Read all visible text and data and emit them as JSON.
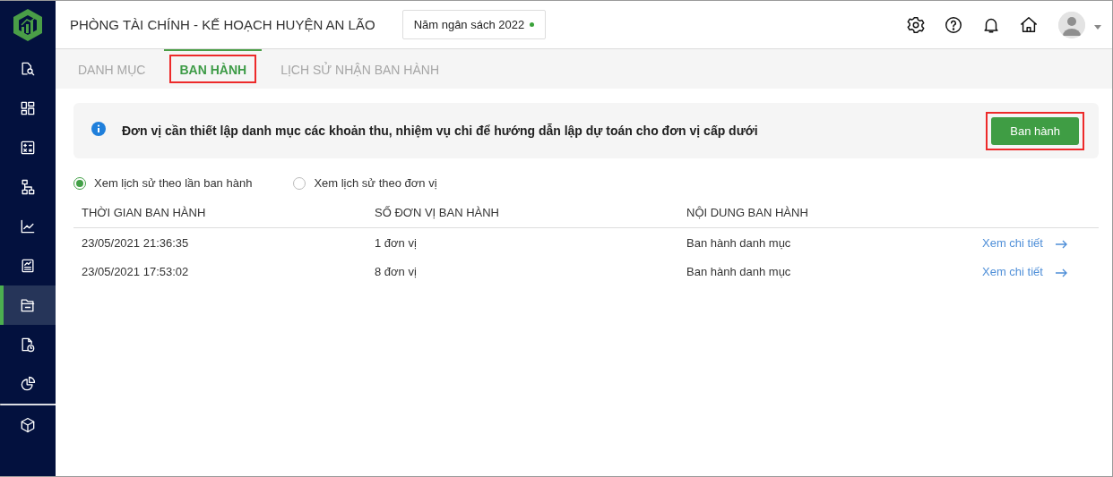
{
  "sidebar": {
    "items": [
      {
        "selected": false
      },
      {
        "selected": false
      },
      {
        "selected": false
      },
      {
        "selected": false
      },
      {
        "selected": false
      },
      {
        "selected": false
      },
      {
        "selected": true
      },
      {
        "selected": false
      },
      {
        "selected": false
      },
      {
        "selected": false
      }
    ]
  },
  "header": {
    "title": "PHÒNG TÀI CHÍNH - KẾ HOẠCH HUYỆN AN LÃO",
    "budget_year": "Năm ngân sách 2022"
  },
  "tabs": [
    {
      "label": "DANH MỤC",
      "selected": false,
      "highlighted": false
    },
    {
      "label": "BAN HÀNH",
      "selected": true,
      "highlighted": true
    },
    {
      "label": "LỊCH SỬ NHẬN BAN HÀNH",
      "selected": false,
      "highlighted": false
    }
  ],
  "banner": {
    "text": "Đơn vị cần thiết lập danh mục các khoản thu, nhiệm vụ chi để hướng dẫn lập dự toán cho đơn vị cấp dưới",
    "button": {
      "label": "Ban hành",
      "highlighted": true
    }
  },
  "view_options": [
    {
      "label": "Xem lịch sử theo lần ban hành",
      "selected": true
    },
    {
      "label": "Xem lịch sử theo đơn vị",
      "selected": false
    }
  ],
  "table": {
    "columns": [
      "THỜI GIAN BAN HÀNH",
      "SỐ ĐƠN VỊ BAN HÀNH",
      "NỘI DUNG BAN HÀNH"
    ],
    "rows": [
      {
        "cells": [
          "23/05/2021 21:36:35",
          "1 đơn vị",
          "Ban hành danh mục"
        ],
        "link": "Xem chi tiết"
      },
      {
        "cells": [
          "23/05/2021 17:53:02",
          "8 đơn vị",
          "Ban hành danh mục"
        ],
        "link": "Xem chi tiết"
      }
    ]
  }
}
